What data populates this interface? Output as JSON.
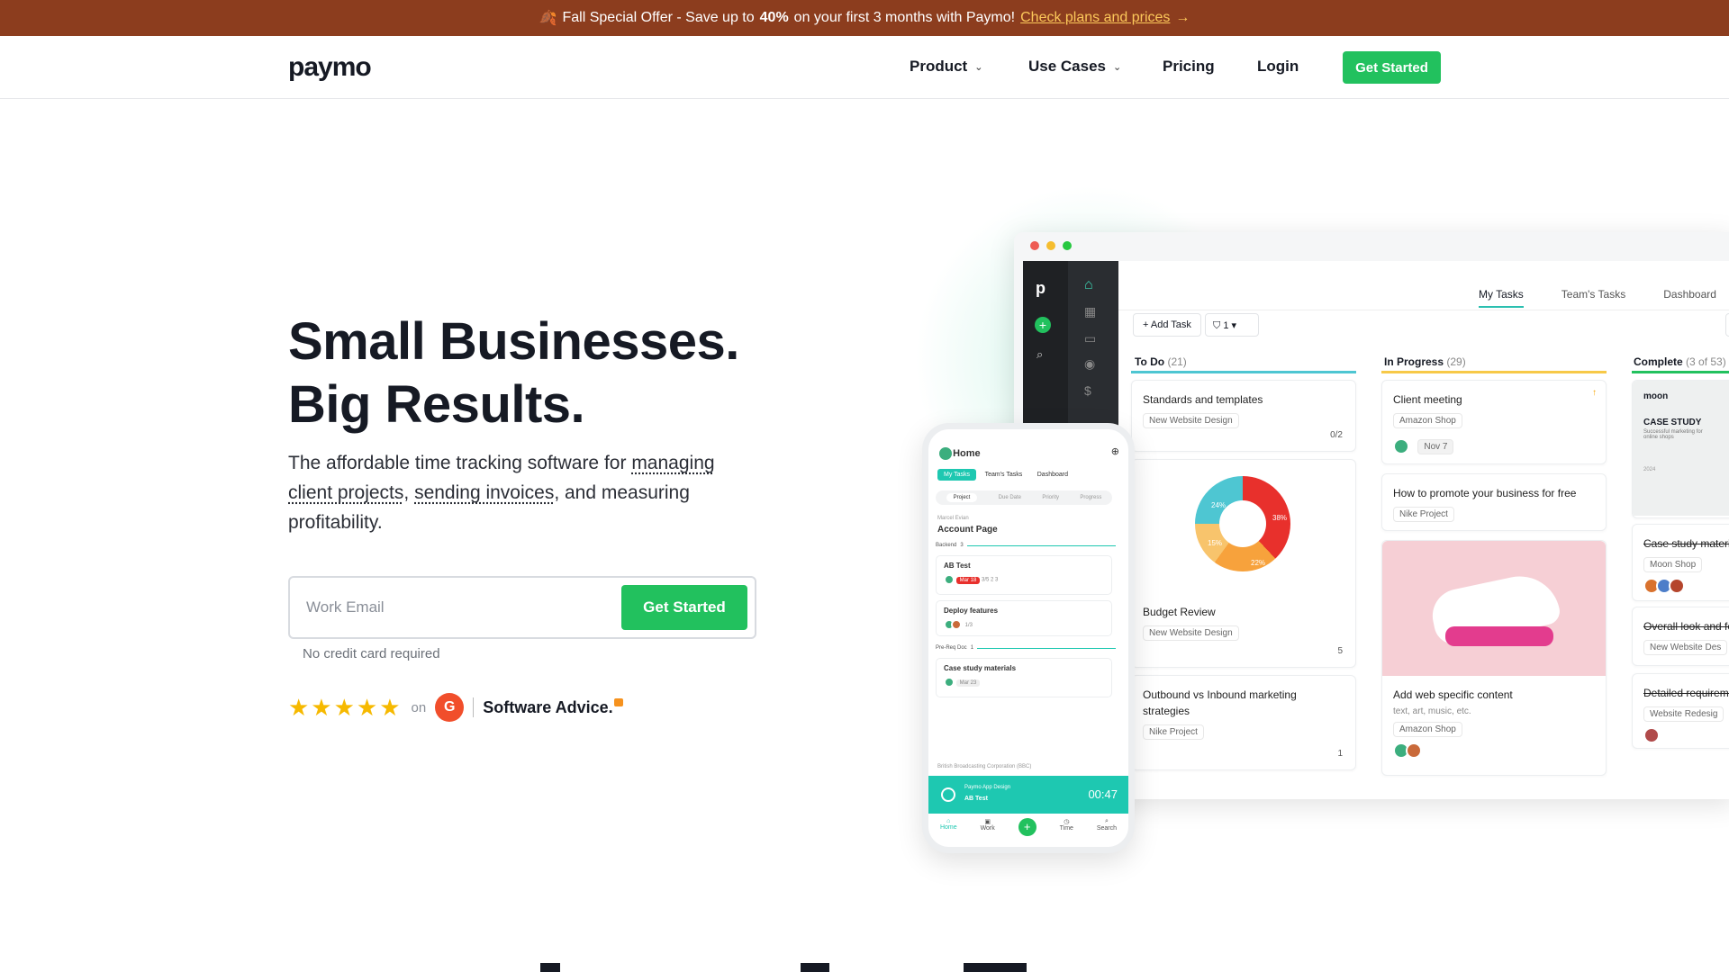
{
  "promo": {
    "emoji": "🍂",
    "text_before": "Fall Special Offer - Save up to",
    "highlight": "40%",
    "text_after": "on your first 3 months with Paymo!",
    "link": "Check plans and prices",
    "arrow": "→",
    "bg_color": "#8c3d1e",
    "link_color": "#fcc85a"
  },
  "header": {
    "logo": "paymo",
    "nav": [
      {
        "label": "Product",
        "dropdown": true
      },
      {
        "label": "Use Cases",
        "dropdown": true
      },
      {
        "label": "Pricing",
        "dropdown": false
      },
      {
        "label": "Login",
        "dropdown": false
      }
    ],
    "cta": "Get Started",
    "accent": "#22c15e"
  },
  "hero": {
    "title_line1": "Small Businesses.",
    "title_line2": "Big Results.",
    "sub_before": "The affordable time tracking software for",
    "link1": "managing client projects",
    "link2": "sending invoices",
    "sub_after": ", and measuring profitability.",
    "email_placeholder": "Work Email",
    "cta": "Get Started",
    "no_cc": "No credit card required",
    "stars": "★★★★★",
    "on": "on",
    "g2": "G",
    "software_advice": "Software Advice."
  },
  "app": {
    "tabs": [
      "My Tasks",
      "Team's Tasks",
      "Dashboard"
    ],
    "add_task": "Add Task",
    "filter_count": "1",
    "columns": [
      {
        "name": "To Do",
        "count": "(21)",
        "color": "#4ec6d2"
      },
      {
        "name": "In Progress",
        "count": "(29)",
        "color": "#f7c948"
      },
      {
        "name": "Complete",
        "count": "(3 of 53)",
        "color": "#22c15e"
      }
    ],
    "todo": [
      {
        "title": "Standards and templates",
        "project": "New Website Design",
        "meta": "0/2"
      },
      {
        "title": "Budget Review",
        "project": "New Website Design",
        "meta": "5"
      },
      {
        "title": "Outbound vs Inbound marketing strategies",
        "project": "Nike Project",
        "meta": "1"
      }
    ],
    "donut_labels": [
      "38%",
      "22%",
      "15%",
      "24%"
    ],
    "progress": [
      {
        "title": "Client meeting",
        "project": "Amazon Shop",
        "date": "Nov 7"
      },
      {
        "title": "How to promote your business for free",
        "project": "Nike Project"
      },
      {
        "title": "Add web specific content",
        "desc": "text, art, music, etc.",
        "project": "Amazon Shop"
      }
    ],
    "complete": [
      {
        "title": "Case study materi",
        "project": "Moon Shop"
      },
      {
        "title": "Overall look and fe",
        "project": "New Website Des"
      },
      {
        "title": "Detailed requireme",
        "project": "Website Redesig"
      }
    ],
    "case_study": {
      "brand": "moon",
      "title": "CASE STUDY",
      "desc": "Successful marketing for online shops",
      "year": "2024"
    }
  },
  "phone": {
    "title": "Home",
    "tabs": [
      "My Tasks",
      "Team's Tasks",
      "Dashboard"
    ],
    "subtabs": [
      "Project",
      "Due Date",
      "Priority",
      "Progress"
    ],
    "owner": "Marcel Evian",
    "page": "Account Page",
    "group1": "Backend",
    "group1_count": "3",
    "tasks": [
      {
        "title": "AB Test",
        "badge": "Mar 18",
        "meta": "3/5   2   3"
      },
      {
        "title": "Deploy features",
        "meta": "1/3"
      }
    ],
    "group2": "Pre-Req Doc",
    "group2_count": "1",
    "task3": {
      "title": "Case study materials",
      "date": "Mar 23"
    },
    "org": "British Broadcasting Corporation (BBC)",
    "timer_project": "Paymo App Design",
    "timer_task": "AB Test",
    "timer": "00:47",
    "nav": [
      "Home",
      "Work",
      "Time",
      "Search"
    ]
  }
}
